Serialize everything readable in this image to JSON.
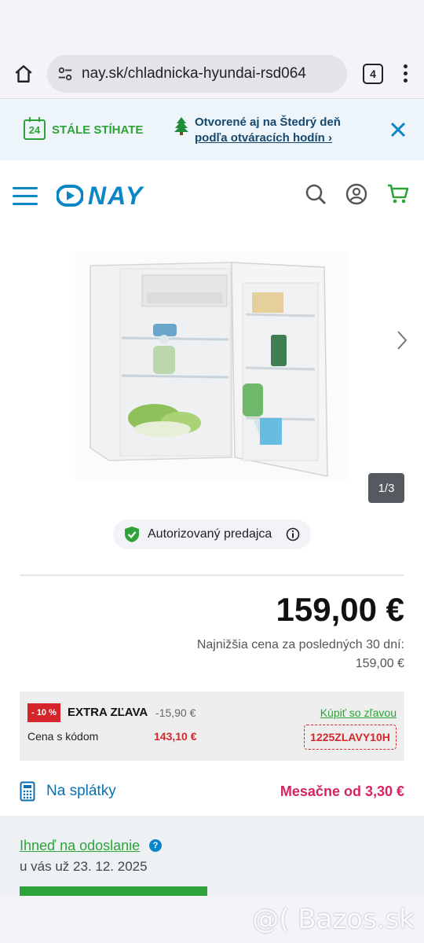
{
  "browser": {
    "url": "nay.sk/chladnicka-hyundai-rsd064",
    "tab_count": "4"
  },
  "promo": {
    "left_badge": "24",
    "left_text": "STÁLE STÍHATE",
    "line1": "Otvorené aj na Štedrý deň",
    "line2": "podľa otváracích hodín"
  },
  "header": {
    "logo_text": "NAY",
    "brand_color": "#0a86c7"
  },
  "gallery": {
    "counter": "1/3"
  },
  "seller_badge": {
    "label": "Autorizovaný predajca"
  },
  "pricing": {
    "price": "159,00 €",
    "lowest_label": "Najnižšia cena za posledných 30 dní:",
    "lowest_value": "159,00 €"
  },
  "discount": {
    "tag": "- 10 %",
    "title": "EXTRA ZĽAVA",
    "amount": "-15,90 €",
    "buy_link": "Kúpiť so zľavou",
    "code_label": "Cena s kódom",
    "code_price": "143,10 €",
    "code": "1225ZLAVY10H"
  },
  "installments": {
    "label": "Na splátky",
    "monthly": "Mesačne od 3,30 €"
  },
  "availability": {
    "title": "Ihneď na odoslanie",
    "date": "u vás už 23. 12. 2025"
  },
  "watermark": "@( Bazos.sk",
  "colors": {
    "accent_green": "#2ea33a",
    "brand_blue": "#0a86c7",
    "sale_red": "#d6252a",
    "installment_pink": "#d6245f"
  }
}
